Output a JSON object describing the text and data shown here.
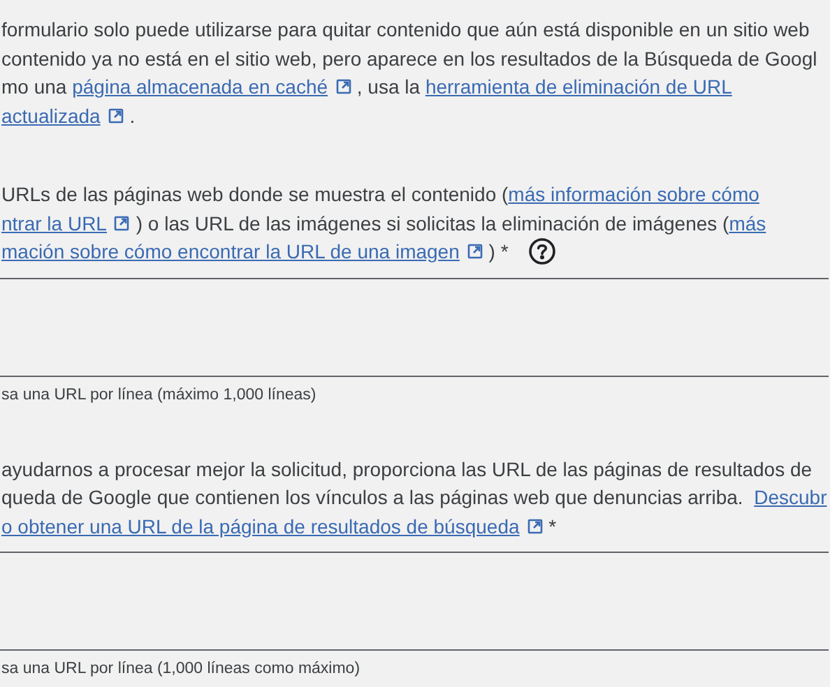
{
  "sections": [
    {
      "paragraph": [
        [
          {
            "kind": "text",
            "text": "formulario solo puede utilizarse para quitar contenido que aún está disponible en un sitio web"
          }
        ],
        [
          {
            "kind": "text",
            "text": "contenido ya no está en el sitio web, pero aparece en los resultados de la Búsqueda de Googl"
          }
        ],
        [
          {
            "kind": "text",
            "text": "mo una "
          },
          {
            "kind": "link",
            "text": "página almacenada en caché",
            "external": true
          },
          {
            "kind": "text",
            "text": " , usa la "
          },
          {
            "kind": "link",
            "text": "herramienta de eliminación de URL",
            "external": false
          }
        ],
        [
          {
            "kind": "link",
            "text": "actualizada",
            "external": true
          },
          {
            "kind": "text",
            "text": " ."
          }
        ]
      ],
      "help": false
    },
    {
      "paragraph": [
        [
          {
            "kind": "text",
            "text": "URLs de las páginas web donde se muestra el contenido ("
          },
          {
            "kind": "link",
            "text": "más información sobre cómo",
            "external": false
          }
        ],
        [
          {
            "kind": "link",
            "text": "ntrar la URL",
            "external": true
          },
          {
            "kind": "text",
            "text": " ) o las URL de las imágenes si solicitas la eliminación de imágenes ("
          },
          {
            "kind": "link",
            "text": "más",
            "external": false
          }
        ],
        [
          {
            "kind": "link",
            "text": "mación sobre cómo encontrar la URL de una imagen",
            "external": true
          },
          {
            "kind": "text",
            "text": " ) *"
          }
        ]
      ],
      "help": true,
      "field": true,
      "hint": "sa una URL por línea (máximo 1,000 líneas)"
    },
    {
      "paragraph": [
        [
          {
            "kind": "text",
            "text": "ayudarnos a procesar mejor la solicitud, proporciona las URL de las páginas de resultados de"
          }
        ],
        [
          {
            "kind": "text",
            "text": "queda de Google que contienen los vínculos a las páginas web que denuncias arriba.  "
          },
          {
            "kind": "link",
            "text": "Descubr",
            "external": false
          }
        ],
        [
          {
            "kind": "link",
            "text": "o obtener una URL de la página de resultados de búsqueda",
            "external": true
          },
          {
            "kind": "text",
            "text": " *"
          }
        ]
      ],
      "help": false,
      "field": true,
      "hint": "sa una URL por línea (1,000 líneas como máximo)"
    }
  ]
}
